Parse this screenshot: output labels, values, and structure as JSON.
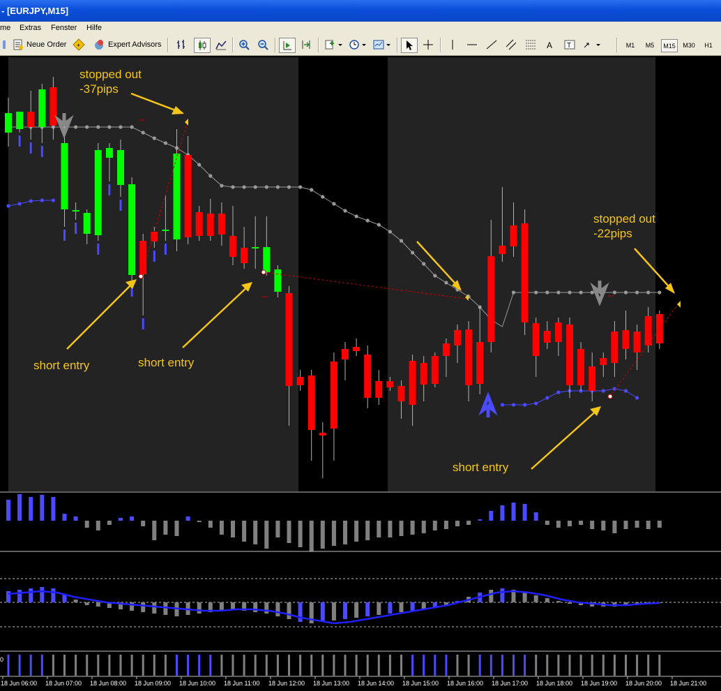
{
  "window": {
    "title": "- [EURJPY,M15]"
  },
  "menu": {
    "items": [
      "me",
      "Extras",
      "Fenster",
      "Hilfe"
    ]
  },
  "toolbar": {
    "new_order": "Neue Order",
    "expert_advisors": "Expert Advisors",
    "timeframes": [
      "M1",
      "M5",
      "M15",
      "M30",
      "H1"
    ],
    "active_timeframe": "M15"
  },
  "annotations": {
    "stopped_out_1": [
      "stopped out",
      "-37pips"
    ],
    "stopped_out_2": [
      "stopped out",
      "-22pips"
    ],
    "short_entry_1": "short entry",
    "short_entry_2": "short entry",
    "short_entry_3": "short entry",
    "color": "#f5c518"
  },
  "colors": {
    "bull": "#00ff00",
    "bear": "#ff0000",
    "indicator_blue": "#4a4aff",
    "indicator_gray": "#808080",
    "shade": "#232323"
  },
  "time_axis": [
    "18 Jun 06:00",
    "18 Jun 07:00",
    "18 Jun 08:00",
    "18 Jun 09:00",
    "18 Jun 10:00",
    "18 Jun 11:00",
    "18 Jun 12:00",
    "18 Jun 13:00",
    "18 Jun 14:00",
    "18 Jun 15:00",
    "18 Jun 16:00",
    "18 Jun 17:00",
    "18 Jun 18:00",
    "18 Jun 19:00",
    "18 Jun 20:00",
    "18 Jun 21:00"
  ],
  "indicator3_label": "0",
  "chart_data": {
    "type": "candlestick",
    "symbol": "EURJPY",
    "timeframe": "M15",
    "y_units": "screen-estimated price levels (no price scale visible)",
    "candles": [
      [
        190,
        162,
        140,
        210
      ],
      [
        185,
        160,
        165,
        190
      ],
      [
        160,
        182,
        130,
        200
      ],
      [
        182,
        128,
        120,
        205
      ],
      [
        125,
        180,
        110,
        200
      ],
      [
        300,
        205,
        175,
        325
      ],
      [
        303,
        301,
        290,
        315
      ],
      [
        335,
        305,
        300,
        350
      ],
      [
        337,
        215,
        205,
        345
      ],
      [
        226,
        212,
        205,
        260
      ],
      [
        265,
        215,
        200,
        282
      ],
      [
        394,
        264,
        254,
        405
      ],
      [
        345,
        393,
        335,
        452
      ],
      [
        332,
        346,
        325,
        355
      ],
      [
        331,
        329,
        280,
        345
      ],
      [
        343,
        220,
        185,
        360
      ],
      [
        222,
        340,
        195,
        350
      ],
      [
        304,
        338,
        295,
        345
      ],
      [
        306,
        338,
        285,
        345
      ],
      [
        306,
        336,
        290,
        352
      ],
      [
        338,
        368,
        295,
        380
      ],
      [
        355,
        377,
        325,
        385
      ],
      [
        355,
        354,
        310,
        385
      ],
      [
        390,
        354,
        310,
        395
      ],
      [
        418,
        386,
        380,
        426
      ],
      [
        420,
        553,
        410,
        610
      ],
      [
        540,
        552,
        530,
        560
      ],
      [
        538,
        616,
        530,
        660
      ],
      [
        620,
        624,
        605,
        685
      ],
      [
        518,
        614,
        505,
        660
      ],
      [
        500,
        515,
        490,
        545
      ],
      [
        497,
        503,
        485,
        510
      ],
      [
        508,
        570,
        495,
        585
      ],
      [
        546,
        570,
        530,
        580
      ],
      [
        546,
        555,
        540,
        560
      ],
      [
        553,
        575,
        545,
        600
      ],
      [
        517,
        580,
        508,
        610
      ],
      [
        520,
        551,
        510,
        575
      ],
      [
        510,
        550,
        505,
        555
      ],
      [
        492,
        510,
        485,
        540
      ],
      [
        473,
        495,
        465,
        520
      ],
      [
        472,
        552,
        460,
        575
      ],
      [
        490,
        550,
        440,
        565
      ],
      [
        367,
        490,
        315,
        505
      ],
      [
        352,
        364,
        268,
        375
      ],
      [
        323,
        353,
        290,
        368
      ],
      [
        320,
        462,
        300,
        480
      ],
      [
        463,
        510,
        455,
        540
      ],
      [
        474,
        491,
        460,
        500
      ],
      [
        462,
        490,
        455,
        510
      ],
      [
        465,
        552,
        455,
        570
      ],
      [
        500,
        552,
        490,
        560
      ],
      [
        525,
        560,
        505,
        575
      ],
      [
        513,
        523,
        505,
        540
      ],
      [
        475,
        520,
        460,
        540
      ],
      [
        473,
        500,
        445,
        515
      ],
      [
        475,
        505,
        465,
        530
      ],
      [
        453,
        495,
        440,
        505
      ],
      [
        450,
        492,
        445,
        500
      ]
    ],
    "upper_line": [
      182,
      182,
      182,
      182,
      182,
      182,
      182,
      182,
      182,
      182,
      182,
      182,
      190,
      198,
      205,
      212,
      222,
      236,
      252,
      266,
      268,
      268,
      268,
      268,
      268,
      268,
      268,
      272,
      282,
      292,
      302,
      310,
      316,
      322,
      332,
      345,
      362,
      378,
      395,
      405,
      415,
      425,
      440,
      458,
      468,
      419,
      419,
      419,
      419,
      419,
      419,
      419,
      419,
      419,
      419,
      419,
      419,
      419,
      419
    ],
    "lower_line": [
      295,
      292,
      288,
      287,
      287
    ],
    "lower_line_2": [
      580,
      580,
      580,
      578,
      570,
      562,
      560,
      560,
      560,
      560,
      557,
      560,
      570
    ],
    "sub1_histogram": [
      30,
      38,
      34,
      37,
      34,
      10,
      6,
      -10,
      -14,
      -6,
      4,
      6,
      -8,
      -28,
      -20,
      -22,
      6,
      -2,
      -10,
      -20,
      -24,
      -30,
      -34,
      -40,
      -24,
      -32,
      -38,
      -44,
      -40,
      -36,
      -34,
      -30,
      -28,
      -24,
      -24,
      -22,
      -20,
      -18,
      -14,
      -12,
      -8,
      -6,
      2,
      14,
      22,
      26,
      24,
      12,
      -6,
      -10,
      -8,
      -6,
      -12,
      -14,
      -18,
      -12,
      -10,
      -12,
      -10
    ],
    "sub2_histogram": [
      16,
      18,
      20,
      22,
      20,
      12,
      4,
      -4,
      -6,
      -8,
      -10,
      -12,
      -14,
      -16,
      -18,
      -20,
      -18,
      -16,
      -14,
      -12,
      -10,
      -12,
      -14,
      -16,
      -20,
      -24,
      -28,
      -30,
      -28,
      -26,
      -24,
      -22,
      -20,
      -18,
      -16,
      -14,
      -12,
      -10,
      -8,
      -4,
      2,
      8,
      14,
      18,
      20,
      18,
      14,
      10,
      6,
      2,
      -2,
      -4,
      -6,
      -6,
      -6,
      -4,
      -2,
      -2,
      0
    ],
    "sub2_signal": [
      12,
      14,
      16,
      14,
      8,
      4,
      0,
      -2,
      -4,
      -6,
      -8,
      -10,
      -12,
      -12,
      -10,
      -10,
      -12,
      -16,
      -22,
      -26,
      -30,
      -28,
      -24,
      -20,
      -16,
      -12,
      -8,
      -4,
      2,
      8,
      14,
      16,
      14,
      10,
      4,
      0,
      -2,
      -4,
      -4,
      -2,
      -1
    ],
    "sub3_bars": [
      0,
      1,
      1,
      1,
      1,
      1,
      1,
      1,
      1,
      1,
      0,
      0,
      0,
      0,
      1,
      1,
      1,
      0,
      0,
      0,
      1,
      1,
      1,
      1,
      1,
      1,
      1,
      1,
      1,
      1,
      1,
      1,
      1,
      1,
      1,
      1,
      0,
      0,
      0,
      1,
      1,
      1,
      1,
      0,
      0,
      1,
      0,
      0,
      1,
      1,
      1,
      1,
      1,
      1,
      1,
      1,
      1,
      1,
      0
    ]
  }
}
